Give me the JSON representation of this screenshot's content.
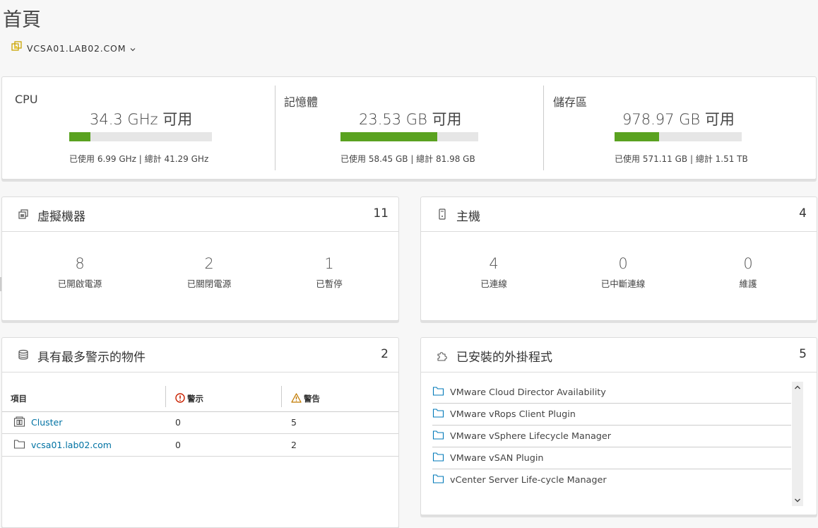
{
  "page": {
    "title": "首頁",
    "vcenter": "VCSA01.LAB02.COM"
  },
  "capacity": [
    {
      "label": "CPU",
      "free": "34.3 GHz 可用",
      "used_fraction": 0.15,
      "detail": "已使用 6.99 GHz | 總計 41.29 GHz"
    },
    {
      "label": "記憶體",
      "free": "23.53 GB 可用",
      "used_fraction": 0.7,
      "detail": "已使用 58.45 GB | 總計 81.98 GB"
    },
    {
      "label": "儲存區",
      "free": "978.97 GB 可用",
      "used_fraction": 0.35,
      "detail": "已使用 571.11 GB | 總計 1.51 TB"
    }
  ],
  "vms": {
    "title": "虛擬機器",
    "count": "11",
    "stats": [
      {
        "value": "8",
        "label": "已開啟電源"
      },
      {
        "value": "2",
        "label": "已關閉電源"
      },
      {
        "value": "1",
        "label": "已暫停"
      }
    ]
  },
  "hosts": {
    "title": "主機",
    "count": "4",
    "stats": [
      {
        "value": "4",
        "label": "已連線"
      },
      {
        "value": "0",
        "label": "已中斷連線"
      },
      {
        "value": "0",
        "label": "維護"
      }
    ]
  },
  "alarms": {
    "title": "具有最多警示的物件",
    "count": "2",
    "columns": {
      "item": "項目",
      "alerts": "警示",
      "warnings": "警告"
    },
    "rows": [
      {
        "name": "Cluster",
        "icon": "cluster-icon",
        "alerts": "0",
        "warnings": "5"
      },
      {
        "name": "vcsa01.lab02.com",
        "icon": "folder-icon",
        "alerts": "0",
        "warnings": "2"
      }
    ]
  },
  "plugins": {
    "title": "已安裝的外掛程式",
    "count": "5",
    "items": [
      "VMware Cloud Director Availability",
      "VMware vRops Client Plugin",
      "VMware vSphere Lifecycle Manager",
      "VMware vSAN Plugin",
      "vCenter Server Life-cycle Manager"
    ]
  },
  "colors": {
    "bar_fill": "#5aa220",
    "bar_track": "#e6e6e6",
    "link": "#0072a3",
    "alert_red": "#c92100",
    "warning_orange": "#c27b00"
  }
}
